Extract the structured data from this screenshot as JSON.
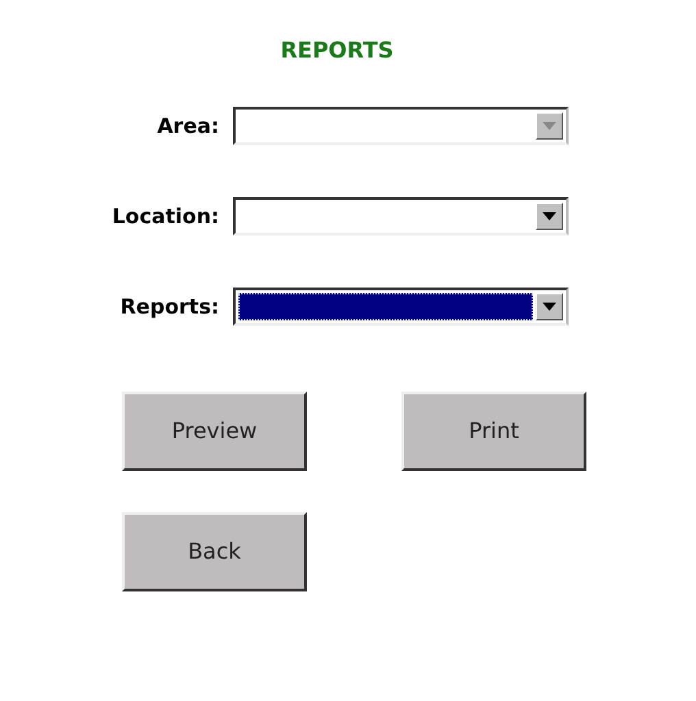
{
  "title": "REPORTS",
  "fields": [
    {
      "label": "Area:",
      "disabled": true,
      "focused": false
    },
    {
      "label": "Location:",
      "disabled": false,
      "focused": false
    },
    {
      "label": "Reports:",
      "disabled": false,
      "focused": true
    }
  ],
  "buttons": [
    [
      "Preview",
      "Print"
    ],
    [
      "Back"
    ]
  ]
}
